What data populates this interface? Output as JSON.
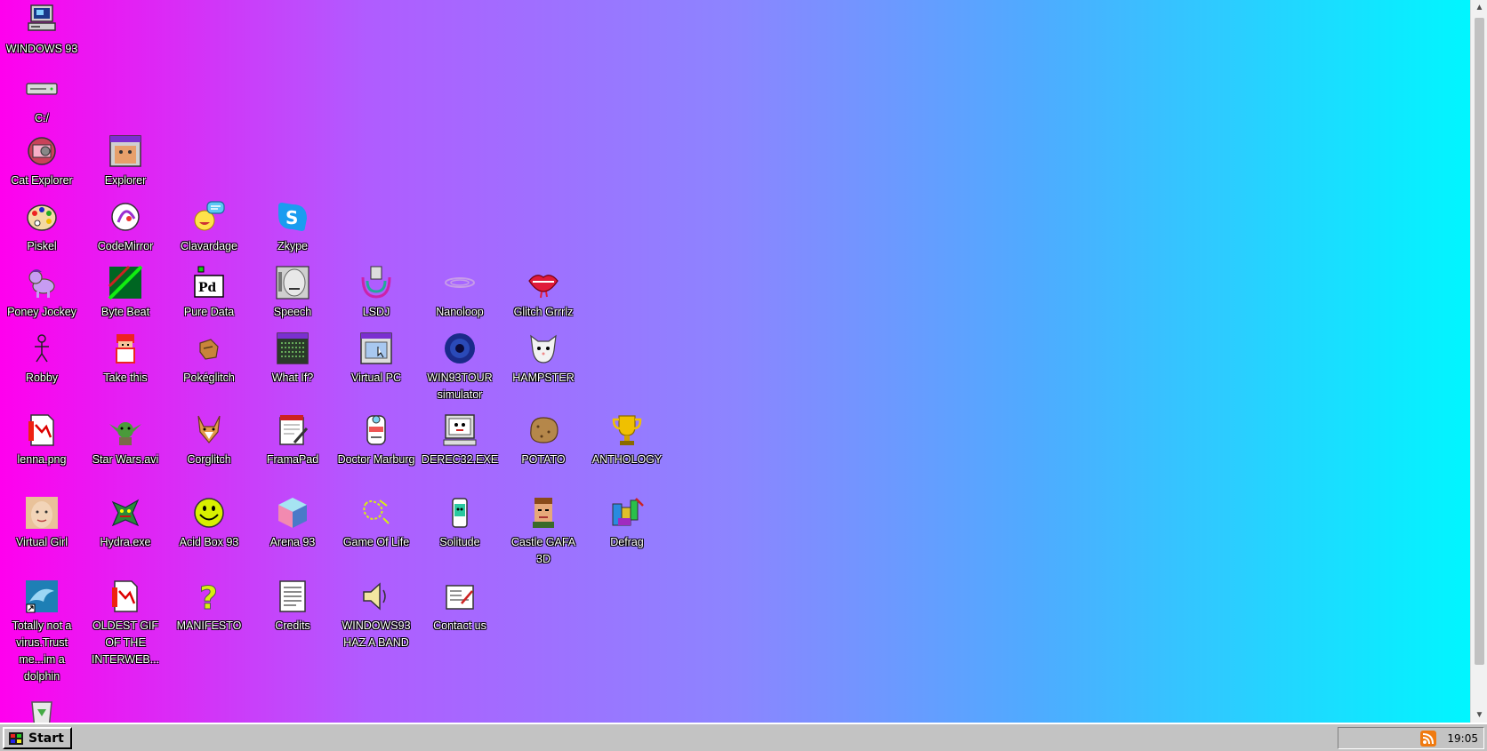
{
  "desktop": {
    "icons": [
      {
        "label": "WINDOWS 93",
        "icon": "computer-icon"
      },
      {
        "label": "C:/",
        "icon": "drive-icon"
      },
      {
        "label": "Cat Explorer",
        "icon": "nyan-cat-icon"
      },
      {
        "label": "Explorer",
        "icon": "explorer-window-icon"
      },
      {
        "label": "Piskel",
        "icon": "palette-icon"
      },
      {
        "label": "CodeMirror",
        "icon": "codemirror-icon"
      },
      {
        "label": "Clavardage",
        "icon": "chat-smiley-icon"
      },
      {
        "label": "Zkype",
        "icon": "zkype-icon"
      },
      {
        "label": "Poney Jockey",
        "icon": "pony-icon"
      },
      {
        "label": "Byte Beat",
        "icon": "bytebeat-icon"
      },
      {
        "label": "Pure Data",
        "icon": "pure-data-icon"
      },
      {
        "label": "Speech",
        "icon": "speech-face-icon"
      },
      {
        "label": "LSDJ",
        "icon": "lsdj-icon"
      },
      {
        "label": "Nanoloop",
        "icon": "nanoloop-icon"
      },
      {
        "label": "Glitch Grrrlz",
        "icon": "lips-icon"
      },
      {
        "label": "Robby",
        "icon": "stick-figure-icon"
      },
      {
        "label": "Take this",
        "icon": "take-this-icon"
      },
      {
        "label": "Pokéglitch",
        "icon": "pokeglitch-icon"
      },
      {
        "label": "What If?",
        "icon": "what-if-icon"
      },
      {
        "label": "Virtual PC",
        "icon": "virtual-pc-icon"
      },
      {
        "label": "WIN93TOUR simulator",
        "icon": "tour-simulator-icon"
      },
      {
        "label": "HAMPSTER",
        "icon": "hamster-icon"
      },
      {
        "label": "lenna.png",
        "icon": "image-file-icon"
      },
      {
        "label": "Star Wars.avi",
        "icon": "yoda-icon"
      },
      {
        "label": "Corglitch",
        "icon": "corgi-icon"
      },
      {
        "label": "FramaPad",
        "icon": "notepad-icon"
      },
      {
        "label": "Doctor Marburg",
        "icon": "doctor-icon"
      },
      {
        "label": "DEREC32.EXE",
        "icon": "derec-computer-icon"
      },
      {
        "label": "POTATO",
        "icon": "potato-icon"
      },
      {
        "label": "ANTHOLOGY",
        "icon": "trophy-icon"
      },
      {
        "label": "Virtual Girl",
        "icon": "virtual-girl-icon"
      },
      {
        "label": "Hydra.exe",
        "icon": "hydra-icon"
      },
      {
        "label": "Acid Box 93",
        "icon": "acid-smiley-icon"
      },
      {
        "label": "Arena 93",
        "icon": "cube-icon"
      },
      {
        "label": "Game Of Life",
        "icon": "game-of-life-icon"
      },
      {
        "label": "Solitude",
        "icon": "solitude-icon"
      },
      {
        "label": "Castle GAFA 3D",
        "icon": "castle-face-icon"
      },
      {
        "label": "Defrag",
        "icon": "defrag-icon"
      },
      {
        "label": "Totally not a virus.Trust me...im a dolphin",
        "icon": "dolphin-icon"
      },
      {
        "label": "OLDEST GIF OF THE INTERWEB...",
        "icon": "gif-file-icon"
      },
      {
        "label": "MANIFESTO",
        "icon": "question-mark-icon"
      },
      {
        "label": "Credits",
        "icon": "document-icon"
      },
      {
        "label": "WINDOWS93 HAZ A BAND",
        "icon": "speaker-icon"
      },
      {
        "label": "Contact us",
        "icon": "contact-form-icon"
      },
      {
        "label": "",
        "icon": "recycle-bin-icon"
      }
    ]
  },
  "taskbar": {
    "start_label": "Start",
    "clock": "19:05",
    "tray_icon": "rss-icon"
  },
  "colors": {
    "gradient_left": "#ff00ee",
    "gradient_right": "#00f6ff",
    "taskbar": "#c3c3c3"
  }
}
